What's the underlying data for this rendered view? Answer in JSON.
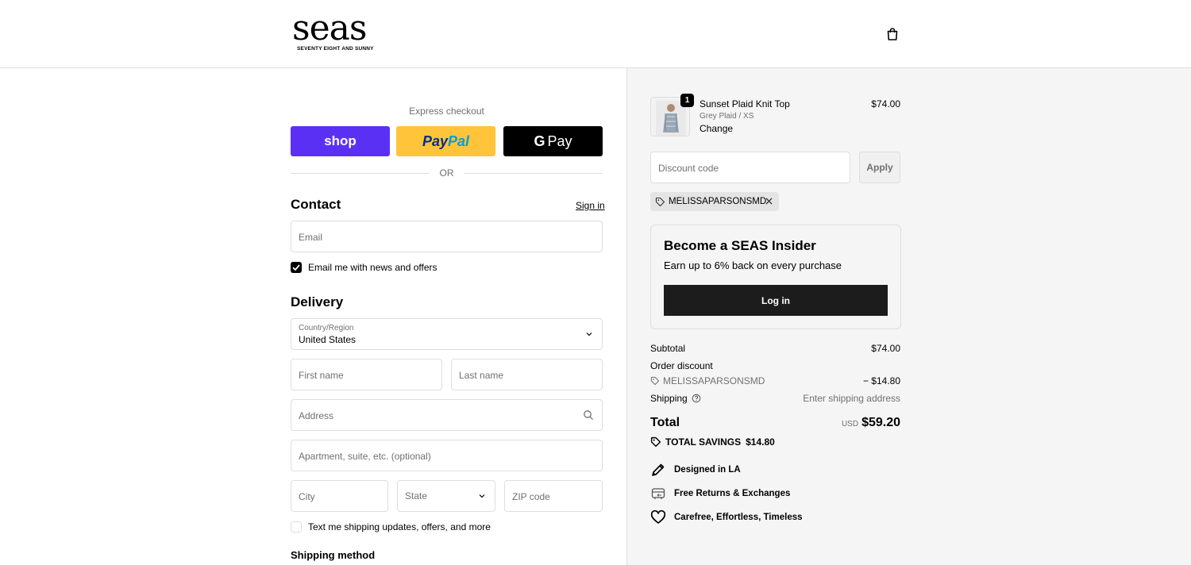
{
  "brand": {
    "logo_word": "seas",
    "logo_tagline": "SEVENTY EIGHT AND SUNNY"
  },
  "express": {
    "label": "Express checkout",
    "shop_label": "shop",
    "paypal_label_a": "Pay",
    "paypal_label_b": "Pal",
    "gpay_g": "G",
    "gpay_label": "Pay",
    "or_label": "OR"
  },
  "contact": {
    "title": "Contact",
    "sign_in": "Sign in",
    "email_placeholder": "Email",
    "news_label": "Email me with news and offers",
    "news_checked": true
  },
  "delivery": {
    "title": "Delivery",
    "country_label": "Country/Region",
    "country_value": "United States",
    "first_name_placeholder": "First name",
    "last_name_placeholder": "Last name",
    "address_placeholder": "Address",
    "apartment_placeholder": "Apartment, suite, etc. (optional)",
    "city_placeholder": "City",
    "state_placeholder": "State",
    "zip_placeholder": "ZIP code",
    "sms_label": "Text me shipping updates, offers, and more",
    "sms_checked": false
  },
  "shipping_method": {
    "title": "Shipping method"
  },
  "cart": {
    "item": {
      "quantity": "1",
      "name": "Sunset Plaid Knit Top",
      "variant": "Grey Plaid / XS",
      "change": "Change",
      "price": "$74.00"
    },
    "discount_placeholder": "Discount code",
    "apply_label": "Apply",
    "applied_code": "MELISSAPARSONSMD"
  },
  "insider": {
    "title": "Become a SEAS Insider",
    "subtitle": "Earn up to 6% back on every purchase",
    "login_label": "Log in"
  },
  "summary": {
    "subtotal_label": "Subtotal",
    "subtotal_value": "$74.00",
    "order_discount_label": "Order discount",
    "discount_code": "MELISSAPARSONSMD",
    "discount_value": "− $14.80",
    "shipping_label": "Shipping",
    "shipping_value": "Enter shipping address",
    "total_label": "Total",
    "total_currency": "USD",
    "total_value": "$59.20",
    "savings_label": "TOTAL SAVINGS",
    "savings_value": "$14.80"
  },
  "features": [
    {
      "label": "Designed in LA",
      "icon": "pencil-icon"
    },
    {
      "label": "Free Returns & Exchanges",
      "icon": "returns-icon"
    },
    {
      "label": "Carefree, Effortless, Timeless",
      "icon": "heart-icon"
    }
  ],
  "colors": {
    "shop_pay": "#5a31f4",
    "paypal": "#ffc439",
    "gpay": "#000000",
    "summary_bg": "#f5f5f5",
    "login_button": "#1c1c1c"
  }
}
